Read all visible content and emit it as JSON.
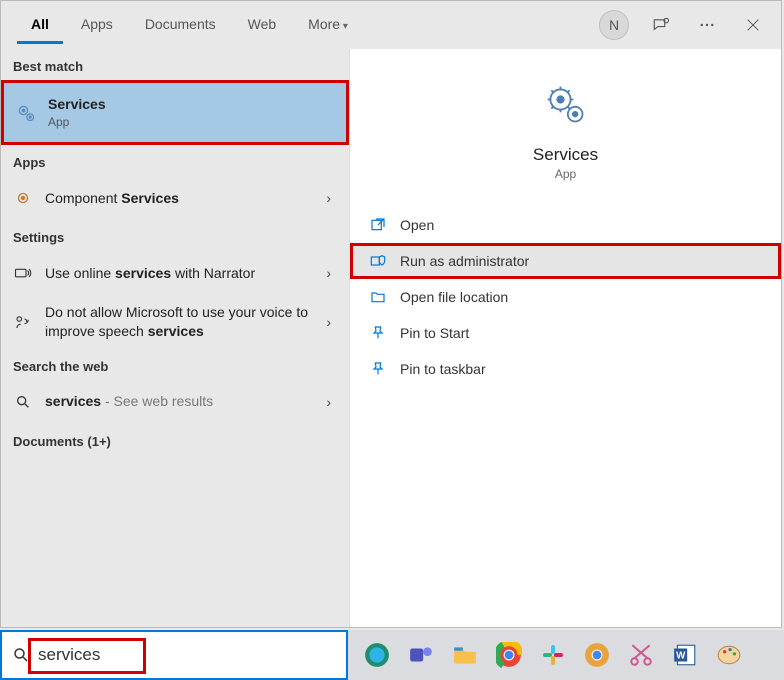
{
  "tabs": {
    "all": "All",
    "apps": "Apps",
    "documents": "Documents",
    "web": "Web",
    "more": "More"
  },
  "user_initial": "N",
  "sections": {
    "best_match": "Best match",
    "apps": "Apps",
    "settings": "Settings",
    "search_web": "Search the web",
    "documents": "Documents (1+)"
  },
  "best_match": {
    "title": "Services",
    "subtitle": "App"
  },
  "apps_results": [
    {
      "prefix": "Component ",
      "bold": "Services"
    }
  ],
  "settings_results": [
    {
      "pre": "Use online ",
      "bold": "services",
      "post": " with Narrator"
    },
    {
      "pre": "Do not allow Microsoft to use your voice to improve speech ",
      "bold": "services",
      "post": ""
    }
  ],
  "web_results": [
    {
      "bold": "services",
      "suffix": " - See web results"
    }
  ],
  "detail": {
    "title": "Services",
    "subtitle": "App",
    "actions": {
      "open": "Open",
      "run_admin": "Run as administrator",
      "open_loc": "Open file location",
      "pin_start": "Pin to Start",
      "pin_taskbar": "Pin to taskbar"
    }
  },
  "search_query": "services"
}
